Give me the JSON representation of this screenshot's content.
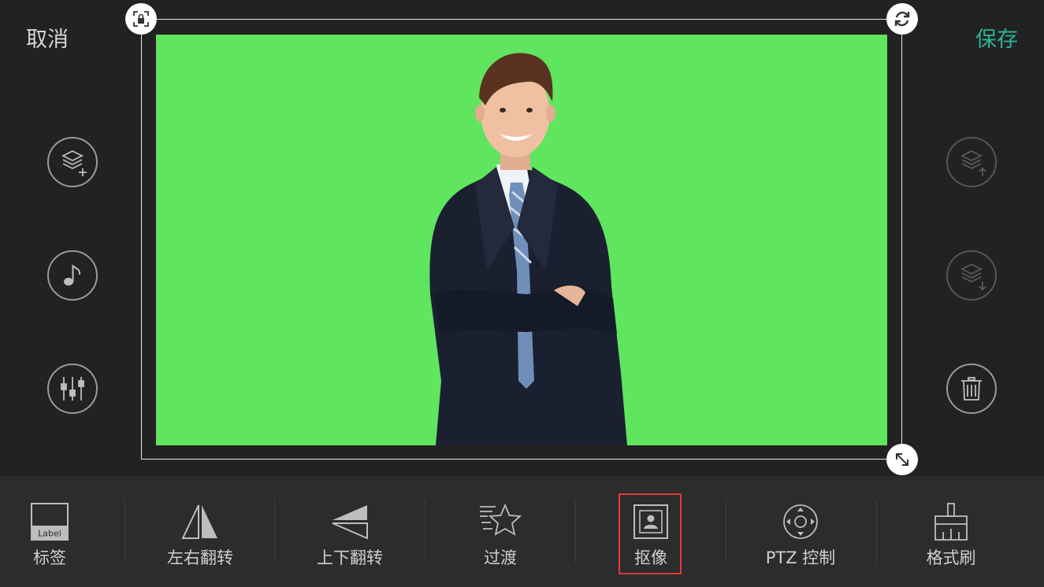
{
  "header": {
    "cancel_label": "取消",
    "save_label": "保存"
  },
  "colors": {
    "background": "#222222",
    "toolbar_bg": "#2c2c2c",
    "save_accent": "#2db294",
    "green_screen": "#5fe55e",
    "selection_border": "#e53935"
  },
  "left_buttons": [
    {
      "name": "add-layer",
      "icon": "layers-plus-icon"
    },
    {
      "name": "music",
      "icon": "music-note-icon"
    },
    {
      "name": "audio-mixer",
      "icon": "sliders-icon"
    }
  ],
  "right_buttons": [
    {
      "name": "layer-up",
      "icon": "layers-up-icon",
      "enabled": false
    },
    {
      "name": "layer-down",
      "icon": "layers-down-icon",
      "enabled": false
    },
    {
      "name": "delete",
      "icon": "trash-icon",
      "enabled": true
    }
  ],
  "canvas": {
    "handles": [
      "lock-icon",
      "rotate-icon",
      "resize-icon"
    ],
    "content": "green-screen photo of a smiling young man in a dark suit and blue striped tie, arms crossed"
  },
  "toolbar": {
    "tools": [
      {
        "label": "标签",
        "icon": "label-icon",
        "icon_text": "Label"
      },
      {
        "label": "左右翻转",
        "icon": "flip-horizontal-icon"
      },
      {
        "label": "上下翻转",
        "icon": "flip-vertical-icon"
      },
      {
        "label": "过渡",
        "icon": "transition-star-icon"
      },
      {
        "label": "抠像",
        "icon": "chroma-key-icon",
        "selected": true
      },
      {
        "label": "PTZ 控制",
        "icon": "ptz-control-icon"
      },
      {
        "label": "格式刷",
        "icon": "format-brush-icon"
      }
    ]
  }
}
